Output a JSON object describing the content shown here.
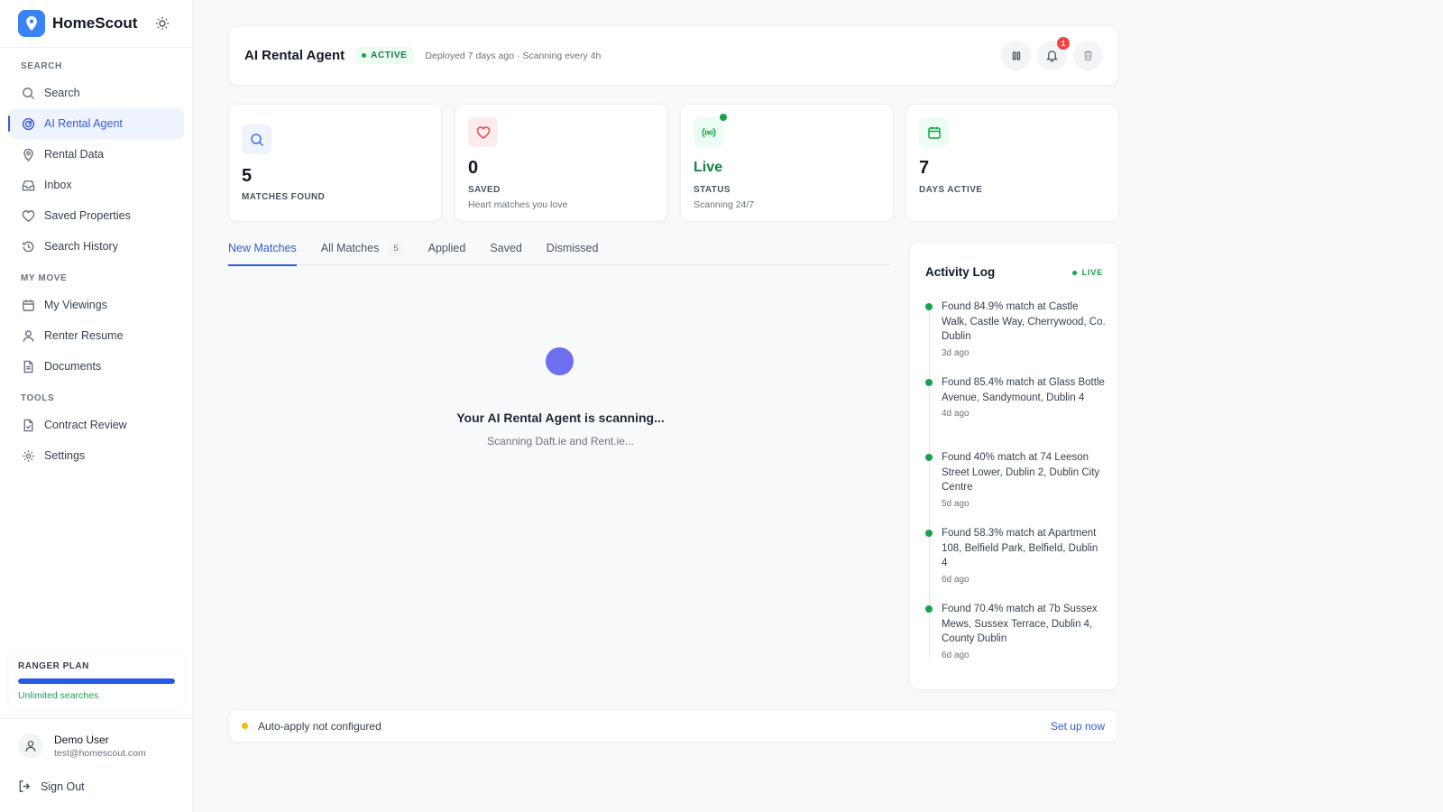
{
  "brand": {
    "name": "HomeScout"
  },
  "sidebar": {
    "sections": [
      {
        "title": "SEARCH",
        "items": [
          {
            "label": "Search",
            "icon": "search-icon"
          },
          {
            "label": "AI Rental Agent",
            "icon": "radar-icon",
            "active": true
          },
          {
            "label": "Rental Data",
            "icon": "map-pin-icon"
          },
          {
            "label": "Inbox",
            "icon": "inbox-icon"
          },
          {
            "label": "Saved Properties",
            "icon": "heart-icon"
          },
          {
            "label": "Search History",
            "icon": "history-icon"
          }
        ]
      },
      {
        "title": "MY MOVE",
        "items": [
          {
            "label": "My Viewings",
            "icon": "calendar-icon"
          },
          {
            "label": "Renter Resume",
            "icon": "user-icon"
          },
          {
            "label": "Documents",
            "icon": "document-icon"
          }
        ]
      },
      {
        "title": "TOOLS",
        "items": [
          {
            "label": "Contract Review",
            "icon": "file-check-icon"
          },
          {
            "label": "Settings",
            "icon": "gear-icon"
          }
        ]
      }
    ],
    "plan": {
      "title": "RANGER PLAN",
      "subtitle": "Unlimited searches",
      "usage_fraction": 1.0
    },
    "user": {
      "name": "Demo User",
      "email": "test@homescout.com"
    },
    "signout_label": "Sign Out"
  },
  "header": {
    "title": "AI Rental Agent",
    "status": "ACTIVE",
    "info": "Deployed 7 days ago · Scanning every 4h",
    "notification_count": "1"
  },
  "stats": [
    {
      "value": "5",
      "label": "MATCHES FOUND",
      "sub": "",
      "icon": "search-icon"
    },
    {
      "value": "0",
      "label": "SAVED",
      "sub": "Heart matches you love",
      "icon": "heart-icon"
    },
    {
      "value": "Live",
      "label": "STATUS",
      "sub": "Scanning 24/7",
      "icon": "broadcast-icon"
    },
    {
      "value": "7",
      "label": "DAYS ACTIVE",
      "sub": "",
      "icon": "calendar-icon"
    }
  ],
  "tabs": [
    {
      "label": "New Matches",
      "active": true
    },
    {
      "label": "All Matches",
      "count": "5"
    },
    {
      "label": "Applied"
    },
    {
      "label": "Saved"
    },
    {
      "label": "Dismissed"
    }
  ],
  "scanning": {
    "title": "Your AI Rental Agent is scanning...",
    "subtitle": "Scanning Daft.ie and Rent.ie..."
  },
  "activity": {
    "title": "Activity Log",
    "live_label": "LIVE",
    "items": [
      {
        "text": "Found 84.9% match at Castle Walk, Castle Way, Cherrywood, Co. Dublin",
        "time": "3d ago"
      },
      {
        "text": "Found 85.4% match at Glass Bottle Avenue, Sandymount, Dublin 4",
        "time": "4d ago"
      },
      {
        "text": "Found 40% match at 74 Leeson Street Lower, Dublin 2, Dublin City Centre",
        "time": "5d ago"
      },
      {
        "text": "Found 58.3% match at Apartment 108, Belfield Park, Belfield, Dublin 4",
        "time": "6d ago"
      },
      {
        "text": "Found 70.4% match at 7b Sussex Mews, Sussex Terrace, Dublin 4, County Dublin",
        "time": "6d ago"
      }
    ]
  },
  "autoapply": {
    "text": "Auto-apply not configured",
    "link": "Set up now"
  },
  "colors": {
    "accent": "#2f5bd8",
    "success": "#16a34a",
    "warning": "#f5b90b",
    "danger": "#ef4444",
    "spinner": "#6d6ff0"
  }
}
